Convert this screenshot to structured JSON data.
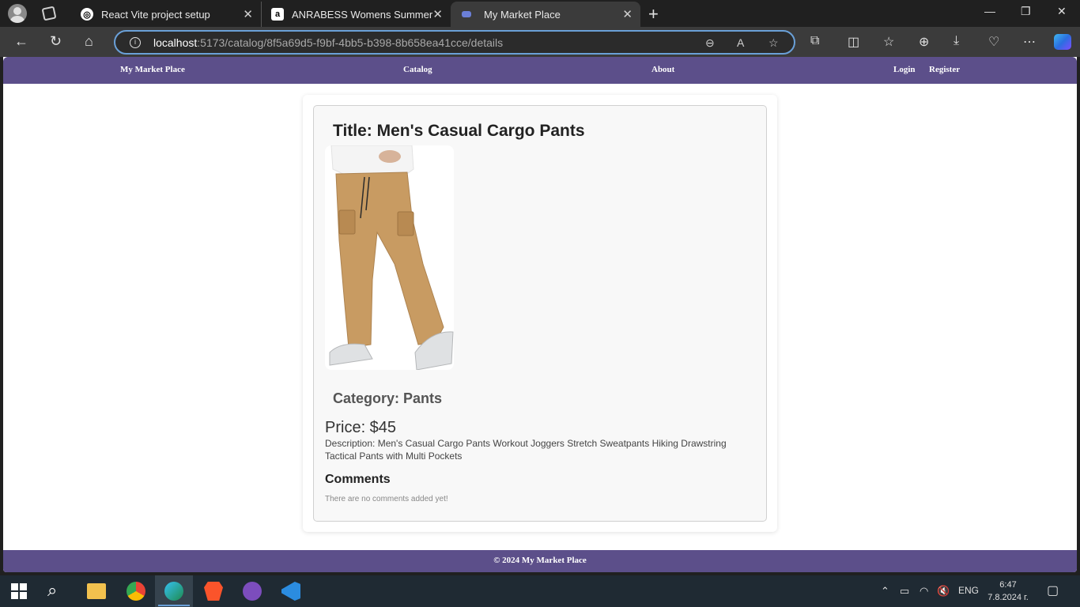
{
  "browser": {
    "tabs": [
      {
        "title": "React Vite project setup",
        "favicon": "chatgpt-icon"
      },
      {
        "title": "ANRABESS Womens Summer Ca",
        "favicon": "amazon-icon"
      },
      {
        "title": "My Market Place",
        "favicon": "page-icon",
        "active": true
      }
    ],
    "url_host": "localhost",
    "url_path": ":5173/catalog/8f5a69d5-f9bf-4bb5-b398-8b658ea41cce/details"
  },
  "nav": {
    "brand": "My Market Place",
    "catalog": "Catalog",
    "about": "About",
    "login": "Login",
    "register": "Register"
  },
  "product": {
    "title": "Title: Men's Casual Cargo Pants",
    "image_alt": "Men's Casual Cargo Pants",
    "category": "Category: Pants",
    "price": "Price: $45",
    "description": "Description: Men's Casual Cargo Pants Workout Joggers Stretch Sweatpants Hiking Drawstring Tactical Pants with Multi Pockets"
  },
  "comments": {
    "heading": "Comments",
    "empty_text": "There are no comments added yet!"
  },
  "footer": {
    "text": "© 2024 My Market Place"
  },
  "taskbar": {
    "language": "ENG",
    "time": "6:47",
    "date": "7.8.2024 г."
  },
  "colors": {
    "accent": "#5c4f8a",
    "url_border": "#6aa0d8"
  }
}
